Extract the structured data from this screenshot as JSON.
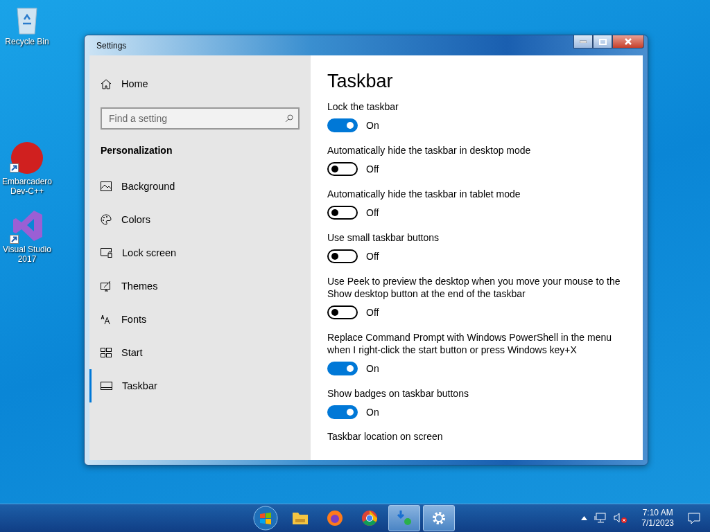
{
  "desktop_icons": [
    {
      "label": "Recycle Bin",
      "shortcut": false
    },
    {
      "label": "Embarcadero Dev-C++",
      "shortcut": true
    },
    {
      "label": "Visual Studio 2017",
      "shortcut": true
    }
  ],
  "window": {
    "title": "Settings",
    "sidebar": {
      "home": "Home",
      "search": {
        "placeholder": "Find a setting"
      },
      "section": "Personalization",
      "items": [
        {
          "label": "Background",
          "selected": false
        },
        {
          "label": "Colors",
          "selected": false
        },
        {
          "label": "Lock screen",
          "selected": false
        },
        {
          "label": "Themes",
          "selected": false
        },
        {
          "label": "Fonts",
          "selected": false
        },
        {
          "label": "Start",
          "selected": false
        },
        {
          "label": "Taskbar",
          "selected": true
        }
      ]
    },
    "page": {
      "title": "Taskbar",
      "settings": [
        {
          "label": "Lock the taskbar",
          "on": true,
          "state_text": "On"
        },
        {
          "label": "Automatically hide the taskbar in desktop mode",
          "on": false,
          "state_text": "Off"
        },
        {
          "label": "Automatically hide the taskbar in tablet mode",
          "on": false,
          "state_text": "Off"
        },
        {
          "label": "Use small taskbar buttons",
          "on": false,
          "state_text": "Off"
        },
        {
          "label": "Use Peek to preview the desktop when you move your mouse to the Show desktop button at the end of the taskbar",
          "on": false,
          "state_text": "Off"
        },
        {
          "label": "Replace Command Prompt with Windows PowerShell in the menu when I right-click the start button or press Windows key+X",
          "on": true,
          "state_text": "On"
        },
        {
          "label": "Show badges on taskbar buttons",
          "on": true,
          "state_text": "On"
        }
      ],
      "next_heading": "Taskbar location on screen"
    }
  },
  "taskbar": {
    "apps": [
      {
        "open": false
      },
      {
        "open": false
      },
      {
        "open": false
      },
      {
        "open": false
      },
      {
        "open": true
      },
      {
        "open": true
      }
    ],
    "time": "7:10 AM",
    "date": "7/1/2023"
  }
}
